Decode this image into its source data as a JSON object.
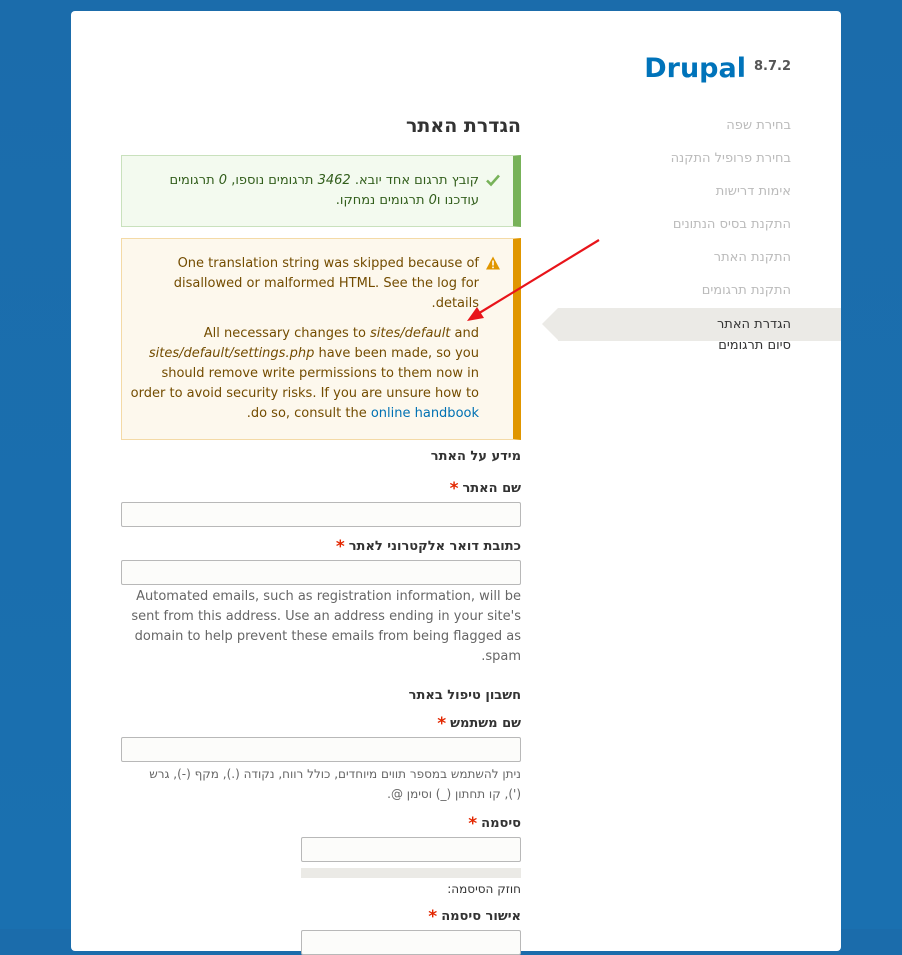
{
  "brand": {
    "name": "Drupal",
    "version": "8.7.2"
  },
  "steps": [
    {
      "label": "בחירת שפה",
      "state": "done"
    },
    {
      "label": "בחירת פרופיל התקנה",
      "state": "done"
    },
    {
      "label": "אימות דרישות",
      "state": "done"
    },
    {
      "label": "התקנת בסיס הנתונים",
      "state": "done"
    },
    {
      "label": "התקנת האתר",
      "state": "done"
    },
    {
      "label": "התקנת תרגומים",
      "state": "done"
    },
    {
      "label": "הגדרת האתר",
      "state": "active"
    },
    {
      "label": "סיום תרגומים",
      "state": "pending"
    }
  ],
  "page": {
    "title": "הגדרת האתר"
  },
  "messages": {
    "status": {
      "before_count": "קובץ תרגום אחד יובא. ",
      "added": "3462",
      "mid1": " תרגומים נוספו, ",
      "updated": "0",
      "mid2": " תרגומים עודכנו ו",
      "deleted": "0",
      "after": " תרגומים נמחקו."
    },
    "warning": {
      "p1": "One translation string was skipped because of disallowed or malformed HTML. See the log for details.",
      "p2_a": "All necessary changes to ",
      "p2_path1": "sites/default",
      "p2_b": " and ",
      "p2_path2": "sites/default/settings.php",
      "p2_c": " have been made, so you should remove write permissions to them now in order to avoid security risks. If you are unsure how to do so, consult the ",
      "p2_link": "online handbook",
      "p2_d": "."
    }
  },
  "site_info": {
    "heading": "מידע על האתר",
    "site_name_label": "שם האתר",
    "site_name_value": "",
    "email_label": "כתובת דואר אלקטרוני לאתר",
    "email_value": "",
    "email_desc": "Automated emails, such as registration information, will be sent from this address. Use an address ending in your site's domain to help prevent these emails from being flagged as spam."
  },
  "admin_account": {
    "heading": "חשבון טיפול באתר",
    "username_label": "שם משתמש",
    "username_value": "",
    "username_desc": "ניתן להשתמש במספר תווים מיוחדים, כולל רווח, נקודה (.), מקף (-), גרש ('), קו תחתון (_) וסימן @.",
    "password_label": "סיסמה",
    "password_value": "",
    "strength_label": "חוזק הסיסמה:",
    "confirm_label": "אישור סיסמה",
    "confirm_value": "",
    "required_mark": "*"
  },
  "colors": {
    "brand": "#0073ba",
    "background": "#1a70b0",
    "status_border": "#77b259",
    "warning_border": "#e09600",
    "required": "#e32700"
  },
  "icons": {
    "status": "checkmark-icon",
    "warning": "warning-triangle-icon"
  }
}
